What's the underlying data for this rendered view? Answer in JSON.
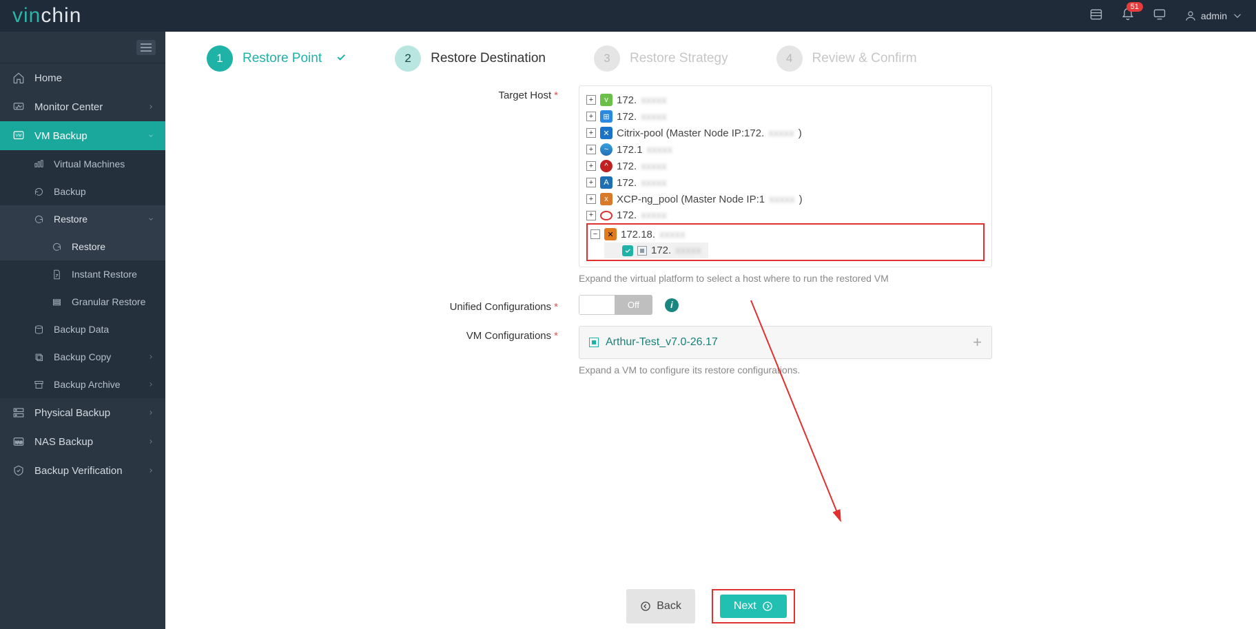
{
  "brand": {
    "part1": "vin",
    "part2": "chin"
  },
  "topbar": {
    "notif_count": "51",
    "username": "admin"
  },
  "sidebar": {
    "home": "Home",
    "monitor_center": "Monitor Center",
    "vm_backup": "VM Backup",
    "virtual_machines": "Virtual Machines",
    "backup": "Backup",
    "restore": "Restore",
    "restore_sub": "Restore",
    "instant_restore": "Instant Restore",
    "granular_restore": "Granular Restore",
    "backup_data": "Backup Data",
    "backup_copy": "Backup Copy",
    "backup_archive": "Backup Archive",
    "physical_backup": "Physical Backup",
    "nas_backup": "NAS Backup",
    "backup_verification": "Backup Verification"
  },
  "wizard": {
    "step1_num": "1",
    "step1_label": "Restore Point",
    "step2_num": "2",
    "step2_label": "Restore Destination",
    "step3_num": "3",
    "step3_label": "Restore Strategy",
    "step4_num": "4",
    "step4_label": "Review & Confirm"
  },
  "form": {
    "target_host_label": "Target Host",
    "unified_conf_label": "Unified Configurations",
    "vm_conf_label": "VM Configurations",
    "toggle_off": "Off",
    "hint_host": "Expand the virtual platform to select a host where to run the restored VM",
    "hint_vmconf": "Expand a VM to configure its restore configurations."
  },
  "tree": {
    "n1": "172.",
    "n2": "172.",
    "n3": "Citrix-pool (Master Node IP:172.",
    "n3_end": ")",
    "n4": "172.1",
    "n5": "172.",
    "n6": "172.",
    "n7": "XCP-ng_pool (Master Node IP:1",
    "n7_end": ")",
    "n8": "172.",
    "n9": "172.18.",
    "n9_child": "172."
  },
  "vm_config": {
    "name": "Arthur-Test_v7.0-26.17"
  },
  "buttons": {
    "back": "Back",
    "next": "Next"
  }
}
